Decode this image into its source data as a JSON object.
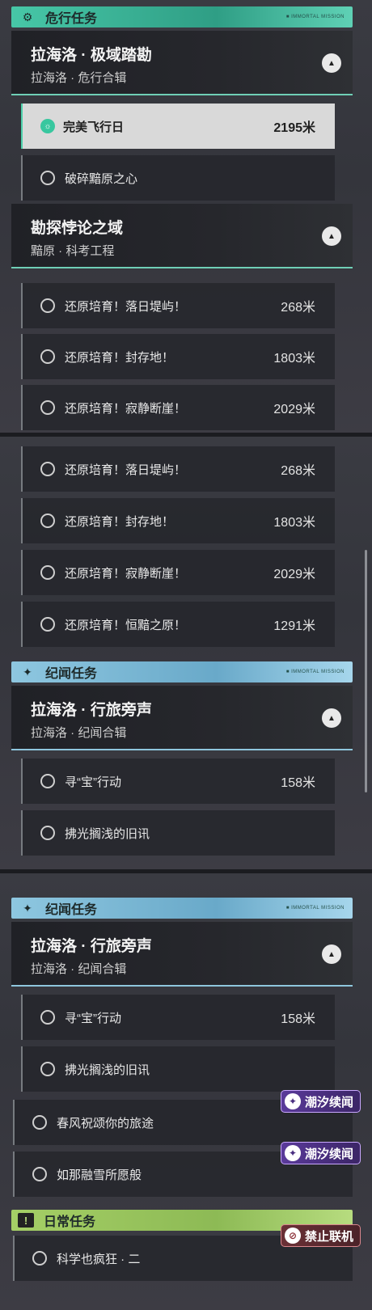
{
  "panel1": {
    "category": {
      "label": "危行任务",
      "tag": "■ IMMORTAL MISSION",
      "icon": "gear-icon"
    },
    "group_a": {
      "title": "拉海洛 · 极域踏勘",
      "subtitle": "拉海洛 · 危行合辑",
      "chevron": "▲"
    },
    "quests_a": [
      {
        "name": "完美飞行日",
        "distance": "2195米",
        "active": true,
        "icon": "☼"
      },
      {
        "name": "破碎黯原之心",
        "distance": "",
        "active": false
      }
    ],
    "group_b": {
      "title": "勘探悖论之域",
      "subtitle": "黯原 · 科考工程",
      "chevron": "▲"
    },
    "quests_b": [
      {
        "name": "还原培育！落日堤屿！",
        "distance": "268米"
      },
      {
        "name": "还原培育！封存地！",
        "distance": "1803米"
      },
      {
        "name": "还原培育！寂静断崖！",
        "distance": "2029米"
      }
    ]
  },
  "panel2": {
    "quests": [
      {
        "name": "还原培育！落日堤屿！",
        "distance": "268米"
      },
      {
        "name": "还原培育！封存地！",
        "distance": "1803米"
      },
      {
        "name": "还原培育！寂静断崖！",
        "distance": "2029米"
      },
      {
        "name": "还原培育！恒黯之原！",
        "distance": "1291米"
      }
    ],
    "category": {
      "label": "纪闻任务",
      "tag": "■ IMMORTAL MISSION",
      "icon": "sparkle-icon"
    },
    "group": {
      "title": "拉海洛 · 行旅旁声",
      "subtitle": "拉海洛 · 纪闻合辑",
      "chevron": "▲"
    },
    "story_quests": [
      {
        "name": "寻“宝”行动",
        "distance": "158米"
      },
      {
        "name": "拂光搁浅的旧讯",
        "distance": ""
      }
    ]
  },
  "panel3": {
    "category": {
      "label": "纪闻任务",
      "tag": "■ IMMORTAL MISSION",
      "icon": "sparkle-icon"
    },
    "group": {
      "title": "拉海洛 · 行旅旁声",
      "subtitle": "拉海洛 · 纪闻合辑",
      "chevron": "▲"
    },
    "story_quests": [
      {
        "name": "寻“宝”行动",
        "distance": "158米"
      },
      {
        "name": "拂光搁浅的旧讯",
        "distance": ""
      },
      {
        "name": "春风祝颂你的旅途",
        "distance": ""
      },
      {
        "name": "如那融雪所愿般",
        "distance": ""
      }
    ],
    "badges": {
      "tide1": "潮汐续闻",
      "tide2": "潮汐续闻",
      "offline": "禁止联机"
    },
    "daily_category": {
      "label": "日常任务",
      "icon": "!"
    },
    "daily_quests": [
      {
        "name": "科学也疯狂 · 二",
        "distance": ""
      }
    ]
  },
  "colors": {
    "danger": "#47c7a7",
    "story": "#8ec7e0",
    "daily": "#a5cf66",
    "tide_badge": "#5a3a9a",
    "offline_badge": "#6a3036"
  }
}
